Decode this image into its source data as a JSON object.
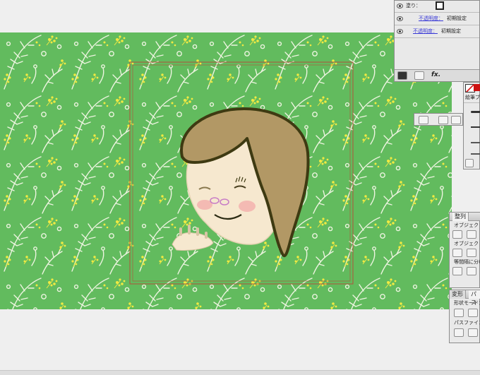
{
  "appearance_panel": {
    "fill_label": "塗り：",
    "rows": [
      {
        "opacity_label": "不透明度：",
        "opacity_value": "初期設定"
      },
      {
        "opacity_label": "不透明度：",
        "opacity_value": "初期設定"
      }
    ],
    "fx_label": "fx."
  },
  "brushes_panel": {
    "title": "絵筆ブ"
  },
  "align_panel": {
    "tab_label": "整列",
    "sections": [
      "オブジェクト",
      "オブジェクト",
      "等間隔に分布"
    ]
  },
  "pathfinder_panel": {
    "tabs": [
      "変形",
      "パス"
    ],
    "shape_mode_label": "形状モード：",
    "pathfinder_label": "パスファインダ"
  },
  "colors": {
    "artwork_green": "#62bb5e",
    "artboard_line": "#b3523b",
    "hair": "#b29865",
    "outline": "#3e3a12",
    "skin": "#f6e8cf"
  }
}
